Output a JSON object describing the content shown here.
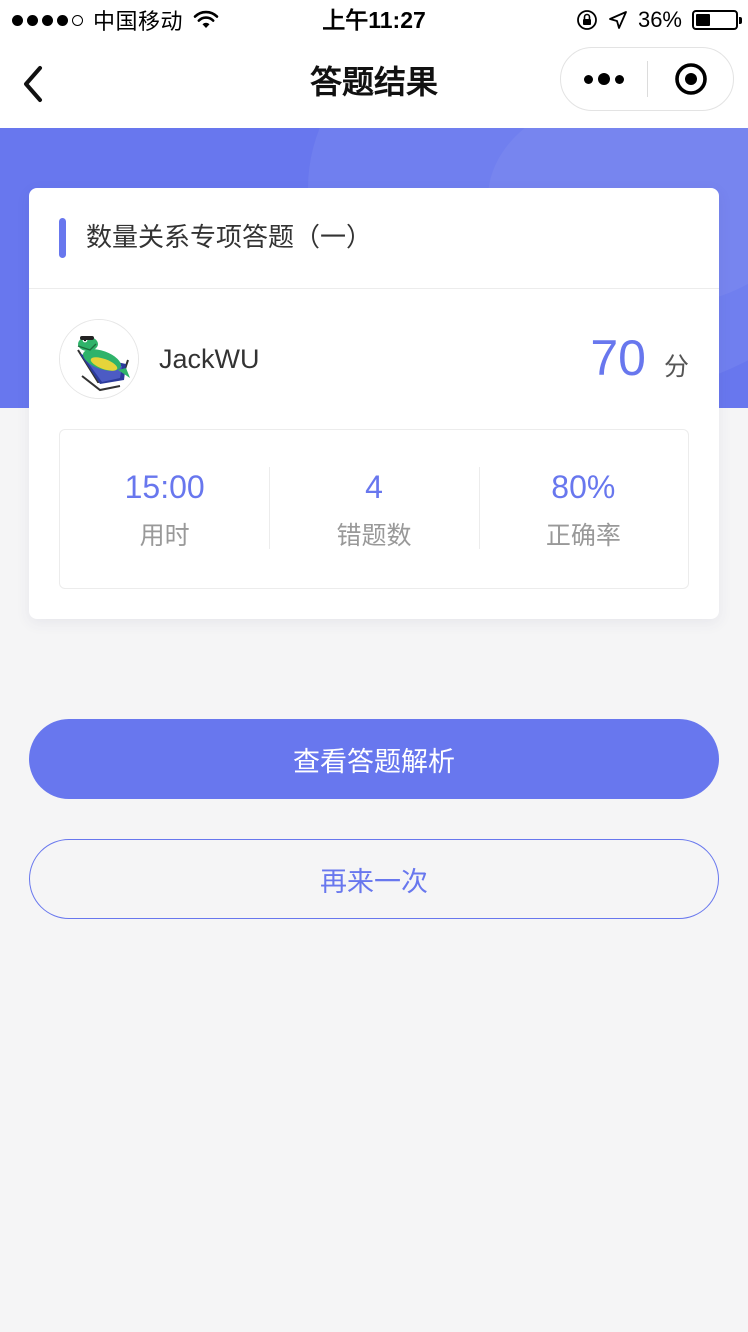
{
  "status_bar": {
    "carrier": "中国移动",
    "time": "上午11:27",
    "battery": "36%",
    "battery_level": 0.36
  },
  "nav": {
    "title": "答题结果",
    "back_icon": "chevron-left-icon",
    "more_icon": "more-dots-icon",
    "close_icon": "target-circle-icon"
  },
  "card": {
    "title": "数量关系专项答题（一）",
    "user": {
      "name": "JackWU",
      "avatar_icon": "crocodile-avatar"
    },
    "score": {
      "value": "70",
      "unit": "分"
    },
    "stats": [
      {
        "value": "15:00",
        "label": "用时"
      },
      {
        "value": "4",
        "label": "错题数"
      },
      {
        "value": "80%",
        "label": "正确率"
      }
    ]
  },
  "actions": {
    "primary_label": "查看答题解析",
    "secondary_label": "再来一次"
  },
  "colors": {
    "accent": "#6877ee",
    "background": "#f5f5f6"
  }
}
